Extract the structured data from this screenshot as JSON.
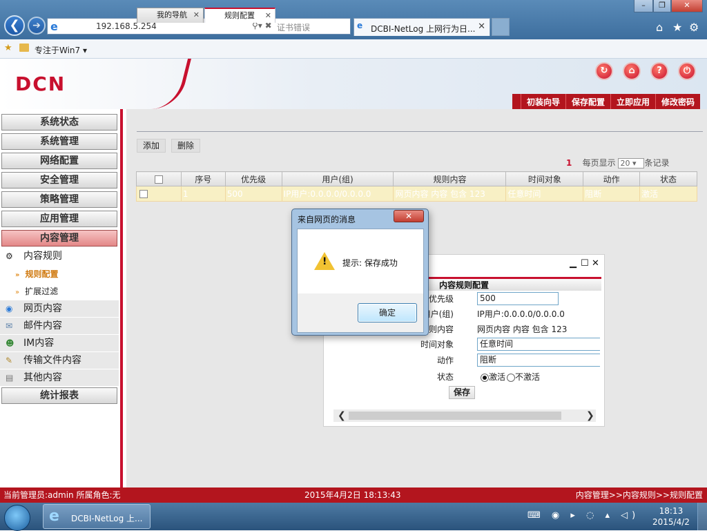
{
  "browser": {
    "back_glyph": "❮",
    "forward_glyph": "➔",
    "address": "192.168.5.254",
    "address_tools": "⚲▾ ✖",
    "cert_error": "证书错误",
    "tab_title": "DCBI-NetLog 上网行为日...",
    "tab_close": "✕",
    "favorites_label": "专注于Win7 ▾",
    "window_buttons": {
      "minimize": "–",
      "restore": "❐",
      "close": "✕"
    },
    "tools_icons": {
      "home": "⌂",
      "favorites": "★",
      "settings": "⚙"
    }
  },
  "header": {
    "logo": "DCN",
    "icons": [
      "↻",
      "⌂",
      "?",
      "⏻"
    ],
    "menu": [
      "初装向导",
      "保存配置",
      "立即应用",
      "修改密码"
    ]
  },
  "sidebar": {
    "buttons": [
      "系统状态",
      "系统管理",
      "网络配置",
      "安全管理",
      "策略管理",
      "应用管理",
      "内容管理"
    ],
    "content_rule": "内容规则",
    "content_subitems": [
      "规则配置",
      "扩展过滤"
    ],
    "items": [
      "网页内容",
      "邮件内容",
      "IM内容",
      "传输文件内容",
      "其他内容"
    ],
    "report": "统计报表"
  },
  "main": {
    "tabs": [
      "我的导航",
      "规则配置"
    ],
    "tab_close": "✕",
    "actions": {
      "add": "添加",
      "delete": "删除"
    },
    "pager": {
      "count": "1",
      "per_page_label": "每页显示",
      "per_page_value": "20",
      "records_label": "条记录"
    },
    "table": {
      "headers": [
        "",
        "序号",
        "优先级",
        "用户(组)",
        "规则内容",
        "时间对象",
        "动作",
        "状态"
      ],
      "rows": [
        {
          "no": "1",
          "priority": "500",
          "user": "IP用户:0.0.0.0/0.0.0.0",
          "rule": "网页内容 内容 包含 123",
          "time": "任意时间",
          "action": "阻断",
          "status": "激活"
        }
      ]
    }
  },
  "config_dialog": {
    "window_controls": [
      "▁",
      "☐",
      "✕"
    ],
    "title": "内容规则配置",
    "fields": {
      "priority_label": "优先级",
      "priority_value": "500",
      "user_label": "用户(组)",
      "user_value": "IP用户:0.0.0.0/0.0.0.0",
      "rule_label": "规则内容",
      "rule_value": "网页内容 内容 包含 123",
      "time_label": "时间对象",
      "time_value": "任意时间",
      "action_label": "动作",
      "action_value": "阻断",
      "status_label": "状态",
      "status_active": "激活",
      "status_inactive": "不激活"
    },
    "save": "保存",
    "scroll_left": "❮",
    "scroll_right": "❯"
  },
  "alert": {
    "title": "来自网页的消息",
    "close": "✕",
    "message": "提示: 保存成功",
    "ok": "确定"
  },
  "statusbar": {
    "admin": "当前管理员:admin  所属角色:无",
    "datetime": "2015年4月2日  18:13:43",
    "breadcrumb": "内容管理>>内容规则>>规则配置"
  },
  "taskbar": {
    "item": "DCBI-NetLog 上...",
    "tray_icons": "⌨ ◉ ▸ ◌ ▴ ◁)",
    "time": "18:13",
    "date": "2015/4/2"
  }
}
